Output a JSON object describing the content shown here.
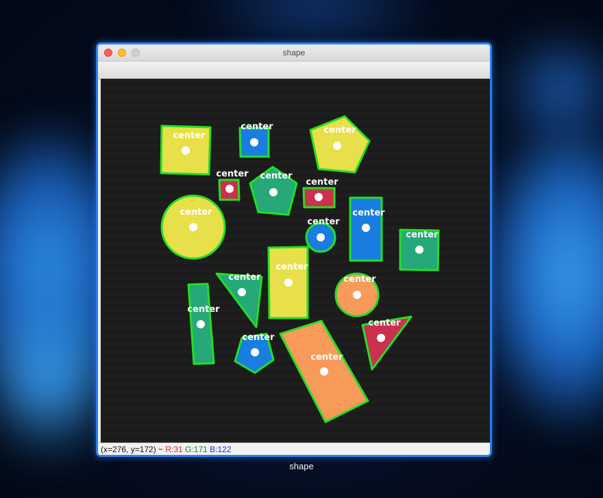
{
  "window": {
    "title": "shape",
    "caption": "shape"
  },
  "status": {
    "coords": "(x=276, y=172) ~ ",
    "r": "R:31",
    "g": "G:171",
    "b": "B:122"
  },
  "colors": {
    "outline": "#22e022",
    "yellow": "#e8e04a",
    "blue": "#1a7ee0",
    "green": "#26a878",
    "red": "#cc3050",
    "orange": "#f79a5a",
    "dot": "#ffffff"
  },
  "shapes": [
    {
      "label": "center",
      "kind": "square",
      "color": "yellow"
    },
    {
      "label": "center",
      "kind": "square",
      "color": "blue"
    },
    {
      "label": "center",
      "kind": "pentagon",
      "color": "yellow"
    },
    {
      "label": "center",
      "kind": "square",
      "color": "red"
    },
    {
      "label": "center",
      "kind": "pentagon",
      "color": "green"
    },
    {
      "label": "center",
      "kind": "rectangle",
      "color": "red"
    },
    {
      "label": "center",
      "kind": "circle",
      "color": "yellow"
    },
    {
      "label": "center",
      "kind": "circle",
      "color": "blue"
    },
    {
      "label": "center",
      "kind": "rectangle",
      "color": "blue"
    },
    {
      "label": "center",
      "kind": "square",
      "color": "green"
    },
    {
      "label": "center",
      "kind": "rectangle",
      "color": "yellow"
    },
    {
      "label": "center",
      "kind": "triangle",
      "color": "green"
    },
    {
      "label": "center",
      "kind": "circle",
      "color": "orange"
    },
    {
      "label": "center",
      "kind": "rectangle",
      "color": "green"
    },
    {
      "label": "center",
      "kind": "triangle",
      "color": "red"
    },
    {
      "label": "center",
      "kind": "pentagon",
      "color": "blue"
    },
    {
      "label": "center",
      "kind": "rectangle",
      "color": "orange"
    }
  ]
}
